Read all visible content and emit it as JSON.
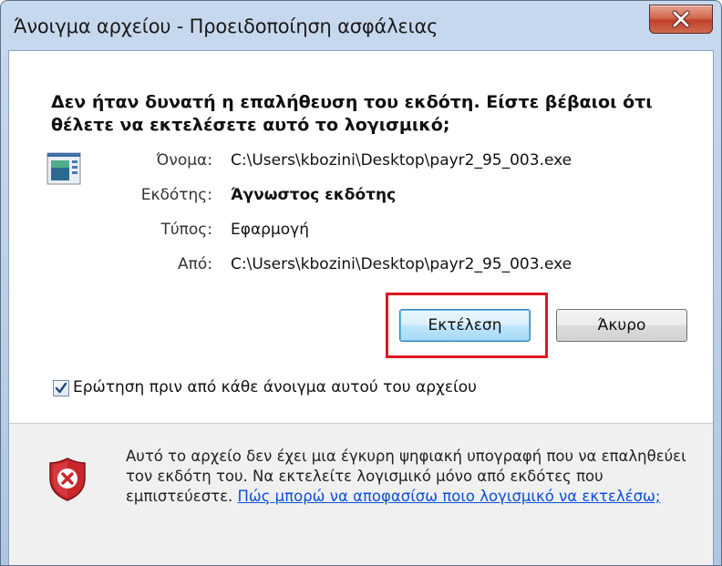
{
  "window": {
    "title": "Άνοιγμα αρχείου - Προειδοποίηση ασφάλειας"
  },
  "dialog": {
    "heading": "Δεν ήταν δυνατή η επαλήθευση του εκδότη. Είστε βέβαιοι ότι θέλετε να εκτελέσετε αυτό το λογισμικό;",
    "fields": [
      {
        "label": "Όνομα:",
        "value": "C:\\Users\\kbozini\\Desktop\\payr2_95_003.exe"
      },
      {
        "label": "Εκδότης:",
        "value": "Άγνωστος εκδότης"
      },
      {
        "label": "Τύπος:",
        "value": "Εφαρμογή"
      },
      {
        "label": "Από:",
        "value": "C:\\Users\\kbozini\\Desktop\\payr2_95_003.exe"
      }
    ],
    "buttons": {
      "run": "Εκτέλεση",
      "cancel": "Άκυρο"
    },
    "checkbox": {
      "label": "Ερώτηση πριν από κάθε άνοιγμα αυτού του αρχείου",
      "checked": true
    },
    "footer": {
      "text": "Αυτό το αρχείο δεν έχει μια έγκυρη ψηφιακή υπογραφή που να επαληθεύει τον εκδότη του. Να εκτελείτε λογισμικό μόνο από εκδότες που εμπιστεύεστε.",
      "link": "Πώς μπορώ να αποφασίσω ποιο λογισμικό να εκτελέσω;"
    }
  },
  "colors": {
    "highlight": "#e0161e",
    "link": "#0a4fd8",
    "shield": "#c8262b"
  },
  "icons": {
    "close": "close-icon",
    "app": "application-icon",
    "warning": "security-shield-icon"
  }
}
